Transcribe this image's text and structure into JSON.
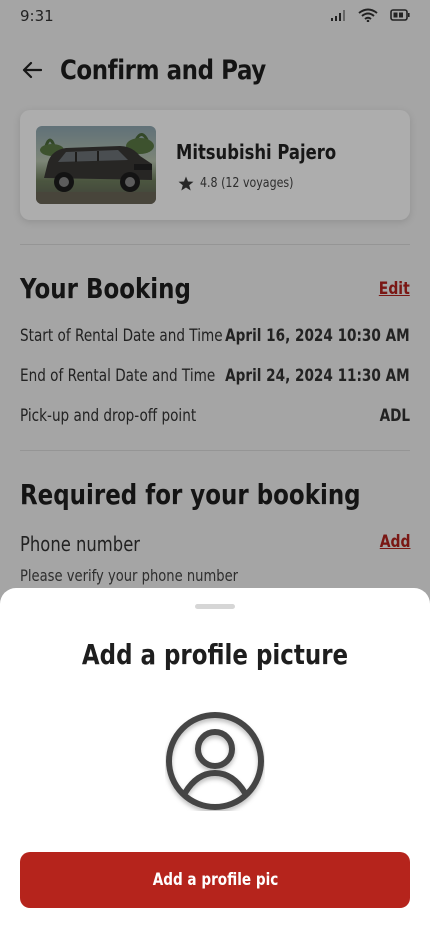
{
  "status_bar": {
    "time": "9:31"
  },
  "header": {
    "title": "Confirm and Pay"
  },
  "car": {
    "name": "Mitsubishi Pajero",
    "rating": "4.8 (12 voyages)"
  },
  "booking": {
    "title": "Your Booking",
    "edit_label": "Edit",
    "rows": [
      {
        "label": "Start of Rental Date and Time",
        "value": "April 16, 2024 10:30 AM"
      },
      {
        "label": "End of Rental Date and Time",
        "value": "April 24, 2024 11:30 AM"
      },
      {
        "label": "Pick-up and drop-off point",
        "value": "ADL"
      }
    ]
  },
  "required": {
    "title": "Required for your booking",
    "phone_label": "Phone number",
    "phone_add_label": "Add",
    "phone_hint": "Please verify your phone number"
  },
  "sheet": {
    "title": "Add a profile picture",
    "button_label": "Add a profile pic"
  },
  "colors": {
    "accent": "#b5241c",
    "background": "#f3f3f3",
    "overlay": "rgba(0,0,0,0.32)"
  }
}
